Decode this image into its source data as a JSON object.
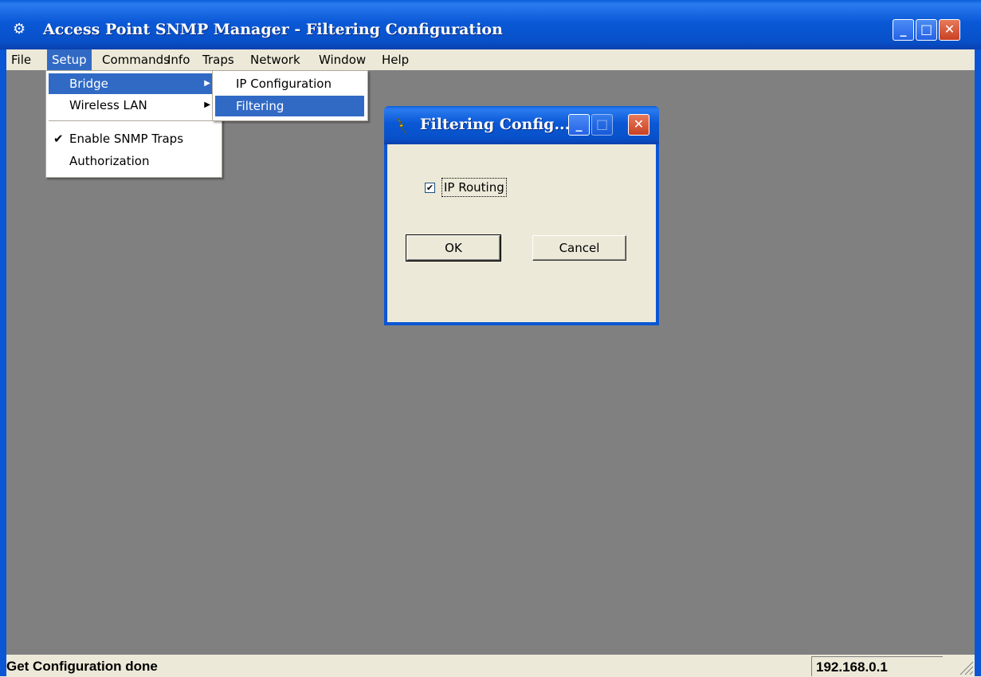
{
  "window": {
    "title": "Access Point SNMP Manager -  Filtering Configuration"
  },
  "menubar": [
    "File",
    "Setup",
    "Commands",
    "Info",
    "Traps",
    "Network",
    "Window",
    "Help"
  ],
  "setup_menu": {
    "items": [
      "Bridge",
      "Wireless LAN",
      "Enable SNMP Traps",
      "Authorization"
    ]
  },
  "bridge_submenu": {
    "items": [
      "IP Configuration",
      "Filtering"
    ]
  },
  "dialog": {
    "title": "Filtering Config...",
    "checkbox_label": "IP Routing",
    "checkbox_checked": true,
    "ok_label": "OK",
    "cancel_label": "Cancel"
  },
  "statusbar": {
    "message": "Get Configuration done",
    "ip": "192.168.0.1"
  },
  "icons": {
    "app": "snmp-manager-icon",
    "dialog": "lightning-icon",
    "minimize": "minimize-icon",
    "maximize": "maximize-icon",
    "close": "close-icon",
    "checkmark": "checkmark-icon",
    "submenu_arrow": "submenu-arrow-icon"
  },
  "colors": {
    "titlebar": "#0a56d4",
    "highlight": "#316ac5",
    "workspace": "#808080",
    "close_button": "#c84124"
  }
}
